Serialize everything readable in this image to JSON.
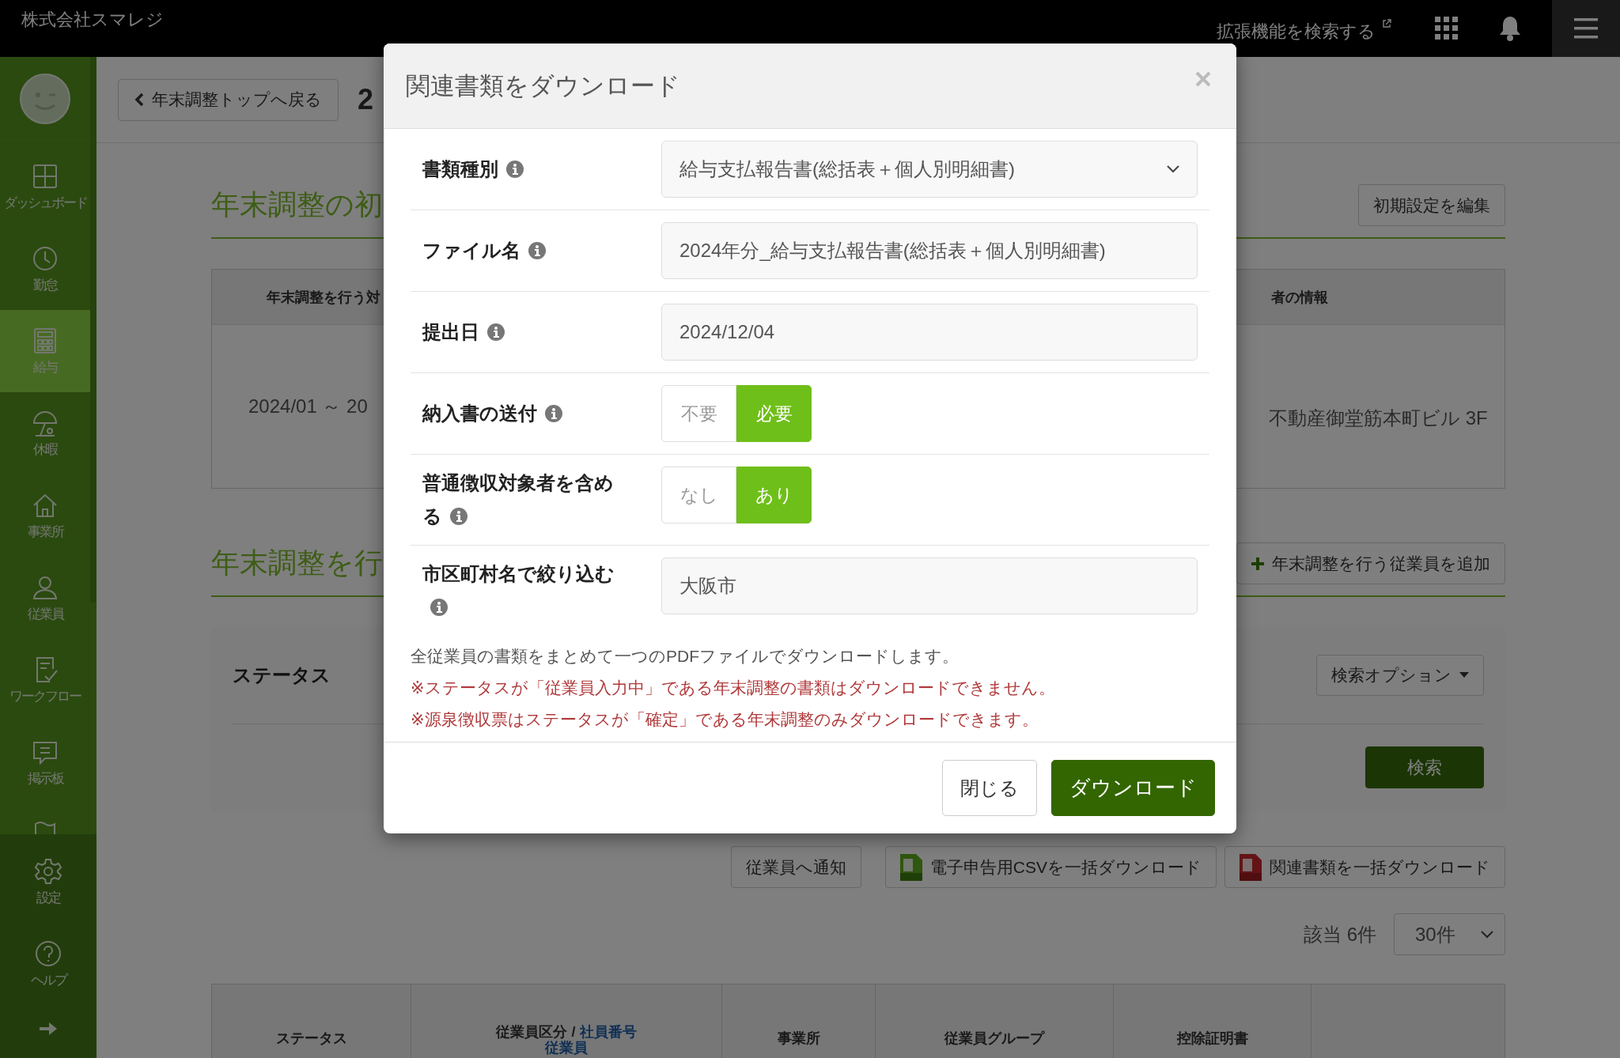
{
  "top_bar": {
    "company": "株式会社スマレジ",
    "extension_search": "拡張機能を検索する"
  },
  "sidebar": {
    "items": [
      {
        "kind": "dashboard",
        "label": "ダッシュボード",
        "selected": false
      },
      {
        "kind": "clock",
        "label": "勤怠",
        "selected": false
      },
      {
        "kind": "calculator",
        "label": "給与",
        "selected": true
      },
      {
        "kind": "umbrella",
        "label": "休暇",
        "selected": false
      },
      {
        "kind": "house",
        "label": "事業所",
        "selected": false
      },
      {
        "kind": "person",
        "label": "従業員",
        "selected": false
      },
      {
        "kind": "workflow",
        "label": "ワークフロー",
        "selected": false
      },
      {
        "kind": "board",
        "label": "掲示板",
        "selected": false
      },
      {
        "kind": "flag",
        "selected": false
      }
    ],
    "bottom_items": [
      {
        "kind": "gear",
        "label": "設定"
      },
      {
        "kind": "help",
        "label": "ヘルプ"
      },
      {
        "kind": "expand"
      }
    ]
  },
  "page": {
    "back_button": "年末調整トップへ戻る",
    "title": "2",
    "settings_section": {
      "title": "年末調整の初",
      "edit_button": "初期設定を編集",
      "table": {
        "columns": [
          "年末調整を行う対",
          "者の情報"
        ],
        "cells": [
          "2024/01 ～ 20",
          "不動産御堂筋本町ビル 3F"
        ]
      }
    },
    "employees_section": {
      "title": "年末調整を行",
      "add_button": "年末調整を行う従業員を追加",
      "search": {
        "label": "ステータス",
        "options_button": "検索オプション",
        "search_button": "検索"
      },
      "actions": [
        {
          "kind": "plain",
          "label": "従業員へ通知"
        },
        {
          "kind": "csv",
          "label": "電子申告用CSVを一括ダウンロード"
        },
        {
          "kind": "pdf",
          "label": "関連書類を一括ダウンロード"
        }
      ],
      "count": "該当 6件",
      "per_page": "30件",
      "table_columns": [
        {
          "label": "ステータス"
        },
        {
          "label": "従業員区分 /",
          "links": [
            "社員番号",
            "従業員"
          ]
        },
        {
          "label": "事業所"
        },
        {
          "label": "従業員グループ"
        },
        {
          "label": "控除証明書"
        }
      ]
    }
  },
  "dialog": {
    "title": "関連書類をダウンロード",
    "fields": [
      {
        "kind": "select",
        "label": "書類種別",
        "value": "給与支払報告書(総括表＋個人別明細書)"
      },
      {
        "kind": "input",
        "label": "ファイル名",
        "value": "2024年分_給与支払報告書(総括表＋個人別明細書)"
      },
      {
        "kind": "input",
        "label": "提出日",
        "value": "2024/12/04"
      },
      {
        "kind": "toggle",
        "label": "納入書の送付",
        "options": [
          {
            "label": "不要",
            "selected": false
          },
          {
            "label": "必要",
            "selected": true
          }
        ]
      },
      {
        "kind": "toggle",
        "label": "普通徴収対象者を含める",
        "options": [
          {
            "label": "なし",
            "selected": false
          },
          {
            "label": "あり",
            "selected": true
          }
        ]
      },
      {
        "kind": "input",
        "label": "市区町村名で絞り込む",
        "value": "大阪市"
      }
    ],
    "notes": [
      {
        "kind": "info",
        "text": "全従業員の書類をまとめて一つのPDFファイルでダウンロードします。"
      },
      {
        "kind": "warning",
        "text": "※ステータスが「従業員入力中」である年末調整の書類はダウンロードできません。"
      },
      {
        "kind": "warning",
        "text": "※源泉徴収票はステータスが「確定」である年末調整のみダウンロードできます。"
      }
    ],
    "buttons": [
      {
        "kind": "secondary",
        "label": "閉じる"
      },
      {
        "kind": "primary",
        "label": "ダウンロード"
      }
    ]
  }
}
